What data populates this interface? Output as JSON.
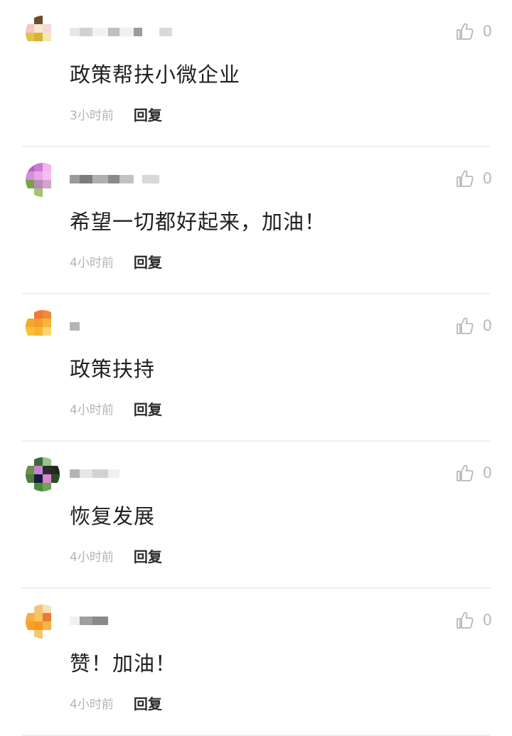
{
  "comments": [
    {
      "text": "政策帮扶小微企业",
      "time": "3小时前",
      "reply_label": "回复",
      "like_count": "0",
      "avatar_colors": [
        "#ffffff",
        "#6b4c2d",
        "#ffffff",
        "#ffffff",
        "#f3c7b9",
        "#f4e7d8",
        "#f6d9d9",
        "#ffffff",
        "#e2c34a",
        "#d6b23a",
        "#f2e8b0",
        "#ffffff",
        "#ffffff",
        "#ffffff",
        "#ffffff",
        "#ffffff"
      ],
      "name_blur": [
        "#e8e8e8",
        "#d0d0d0",
        "#f2f2f2",
        "#bfbfbf",
        "#f0f0f0",
        "#9c9c9c",
        "#ffffff",
        "#d9d9d9"
      ]
    },
    {
      "text": "希望一切都好起来，加油！",
      "time": "4小时前",
      "reply_label": "回复",
      "like_count": "0",
      "avatar_colors": [
        "#b45bc4",
        "#c67bd6",
        "#f0b7ef",
        "#ffffff",
        "#d98cd9",
        "#e7a6e4",
        "#f3c0ee",
        "#ffffff",
        "#7ba146",
        "#b88ac0",
        "#d3a4cb",
        "#ffffff",
        "#ffffff",
        "#a3c36e",
        "#ffffff",
        "#ffffff"
      ],
      "name_blur": [
        "#9a9a9a",
        "#7c7c7c",
        "#b0b0b0",
        "#8a8a8a",
        "#c2c2c2",
        "#ffffff",
        "#d8d8d8"
      ]
    },
    {
      "text": "政策扶持",
      "time": "4小时前",
      "reply_label": "回复",
      "like_count": "0",
      "avatar_colors": [
        "#ffffff",
        "#ee7a33",
        "#f08a37",
        "#ffffff",
        "#f6a829",
        "#f39d2a",
        "#f6b33a",
        "#ffffff",
        "#f9c23d",
        "#f7b431",
        "#f8d576",
        "#ffffff",
        "#ffffff",
        "#ffffff",
        "#ffffff",
        "#ffffff"
      ],
      "name_blur": [
        "#b5b5b5"
      ]
    },
    {
      "text": "恢复发展",
      "time": "4小时前",
      "reply_label": "回复",
      "like_count": "0",
      "avatar_colors": [
        "#ffffff",
        "#3d6a3b",
        "#9ac48e",
        "#ffffff",
        "#6f8f4d",
        "#c683d2",
        "#2b2b2b",
        "#1d2b1a",
        "#4d7f3e",
        "#1a1a3f",
        "#d985cc",
        "#2f4a2a",
        "#ffffff",
        "#4b8b3d",
        "#6aa457",
        "#ffffff"
      ],
      "name_blur": [
        "#b4b4b4",
        "#e6e6e6",
        "#d2d2d2",
        "#f0f0f0"
      ]
    },
    {
      "text": "赞！加油！",
      "time": "4小时前",
      "reply_label": "回复",
      "like_count": "0",
      "avatar_colors": [
        "#ffffff",
        "#f4c37e",
        "#f9e1b6",
        "#ffffff",
        "#f4ae42",
        "#f8c25c",
        "#ee7a33",
        "#ffffff",
        "#f6a22a",
        "#f59a24",
        "#f2b54c",
        "#ffffff",
        "#ffffff",
        "#f7c470",
        "#ffffff",
        "#ffffff"
      ],
      "name_blur": [
        "#f1f1f1",
        "#9f9f9f",
        "#8a8a8a"
      ]
    }
  ],
  "colors": {
    "text": "#1f1f1f",
    "time": "#b3b3b3",
    "reply": "#2a2a2a",
    "like_icon": "#b8b8b8",
    "divider": "#f0f0f0"
  },
  "icons": {
    "like": "thumbs-up-icon"
  }
}
